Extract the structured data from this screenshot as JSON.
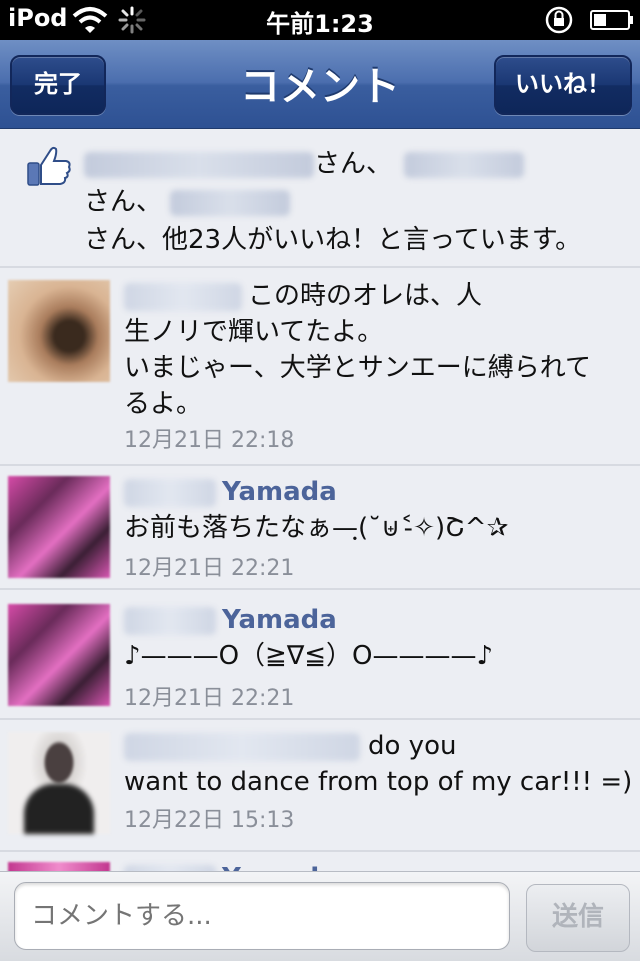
{
  "status_bar": {
    "carrier": "iPod",
    "time": "午前1:23"
  },
  "nav": {
    "title": "コメント",
    "left_button": "完了",
    "right_button": "いいね！"
  },
  "likes": {
    "line1_sep1": "さん、",
    "line2_sep": "さん、",
    "line3": "さん、他23人がいいね！と言っています。"
  },
  "comments": [
    {
      "name_visible": "",
      "lines": [
        "この時のオレは、人",
        "生ノリで輝いてたよ。",
        "いまじゃー、大学とサンエーに縛られて",
        "るよ。"
      ],
      "date": "12月21日 22:18"
    },
    {
      "name_visible": "Yamada",
      "lines": [
        "お前も落ちたなぁ—ฺ(˘⊎˂̵✧)Շ^✰"
      ],
      "date": "12月21日 22:21"
    },
    {
      "name_visible": "Yamada",
      "lines": [
        "♪———O（≧∇≦）O————♪"
      ],
      "date": "12月21日 22:21"
    },
    {
      "name_visible": "",
      "lines": [
        "do you",
        "want to dance from top of my car!!! =)"
      ],
      "date": "12月22日 15:13"
    },
    {
      "name_visible": "Yamada",
      "lines": [],
      "date": ""
    }
  ],
  "composer": {
    "placeholder": "コメントする...",
    "send_label": "送信"
  },
  "colors": {
    "nav_blue": "#3a5e9f",
    "name_blue": "#4c649a",
    "background": "#eceef3"
  },
  "icons": [
    "wifi-icon",
    "activity-spinner-icon",
    "rotation-lock-icon",
    "battery-icon",
    "thumbs-up-icon"
  ]
}
